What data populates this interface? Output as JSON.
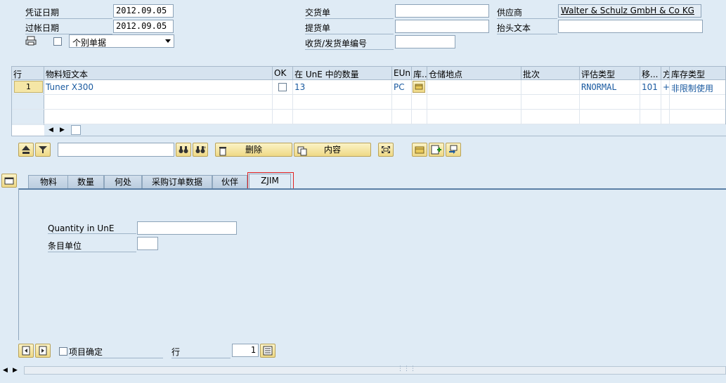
{
  "header": {
    "doc_date_label": "凭证日期",
    "doc_date_value": "2012.09.05",
    "posting_date_label": "过帐日期",
    "posting_date_value": "2012.09.05",
    "item_mode_value": "个别单据",
    "delivery_note_label": "交货单",
    "delivery_note_value": "",
    "bill_of_lading_label": "提货单",
    "bill_of_lading_value": "",
    "gr_gi_slip_label": "收货/发货单编号",
    "gr_gi_slip_value": "",
    "vendor_label": "供应商",
    "vendor_value": "Walter & Schulz GmbH & Co KG",
    "header_text_label": "抬头文本",
    "header_text_value": ""
  },
  "table": {
    "columns": [
      "行",
      "物料短文本",
      "OK",
      "在 UnE 中的数量",
      "EUn",
      "库...",
      "仓储地点",
      "批次",
      "评估类型",
      "移...",
      "方",
      "库存类型"
    ],
    "rows": [
      {
        "line": "1",
        "material_text": "Tuner X300",
        "qty": "13",
        "unit": "PC",
        "storage_loc": "",
        "batch": "",
        "valuation_type": "RNORMAL",
        "movement_type": "101",
        "direction": "+",
        "stock_type": "非限制使用"
      }
    ]
  },
  "toolbar": {
    "delete_label": "删除",
    "contents_label": "内容",
    "search_value": ""
  },
  "tabs": [
    {
      "label": "物料"
    },
    {
      "label": "数量"
    },
    {
      "label": "何处"
    },
    {
      "label": "采购订单数据"
    },
    {
      "label": "伙伴"
    },
    {
      "label": "ZJIM"
    }
  ],
  "zjim": {
    "qty_une_label": "Quantity in UnE",
    "qty_une_value": "",
    "item_unit_label": "条目单位",
    "item_unit_value": ""
  },
  "footer": {
    "item_ok_label": "项目确定",
    "line_label": "行",
    "line_value": "1"
  }
}
